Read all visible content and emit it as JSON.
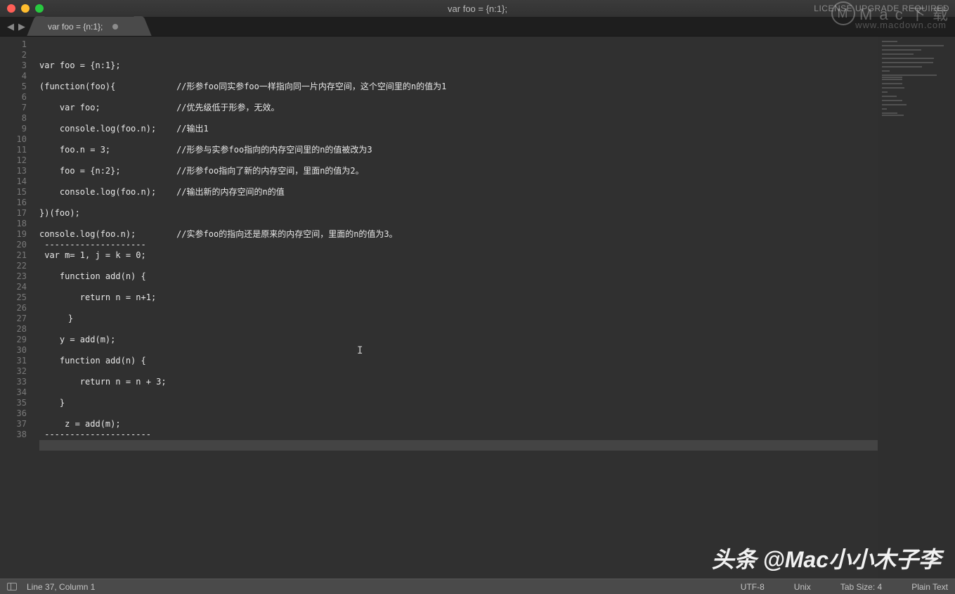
{
  "titlebar": {
    "title": "var foo = {n:1};",
    "right_text": "LICENSE UPGRADE REQUIRED"
  },
  "tab": {
    "label": "var foo = {n:1};"
  },
  "nav": {
    "back": "◀",
    "forward": "▶"
  },
  "lines": [
    "var foo = {n:1};",
    "",
    "(function(foo){            //形参foo同实参foo一样指向同一片内存空间，这个空间里的n的值为1",
    "",
    "    var foo;               //优先级低于形参，无效。",
    "",
    "    console.log(foo.n);    //输出1",
    "",
    "    foo.n = 3;             //形参与实参foo指向的内存空间里的n的值被改为3",
    "",
    "    foo = {n:2};           //形参foo指向了新的内存空间，里面n的值为2。",
    "",
    "    console.log(foo.n);    //输出新的内存空间的n的值",
    "",
    "})(foo);",
    "",
    "console.log(foo.n);        //实参foo的指向还是原来的内存空间，里面的n的值为3。",
    " --------------------",
    " var m= 1, j = k = 0;",
    "",
    "    function add(n) {",
    "",
    "        return n = n+1;",
    "",
    "　    }",
    "",
    "    y = add(m);",
    "",
    "    function add(n) {",
    "",
    "        return n = n + 3;",
    "",
    "    }",
    "",
    "     z = add(m);",
    " ---------------------",
    "",
    ""
  ],
  "line_count": 38,
  "current_line_index": 36,
  "status": {
    "position": "Line 37, Column 1",
    "encoding": "UTF-8",
    "line_ending": "Unix",
    "tab_size": "Tab Size: 4",
    "syntax": "Plain Text"
  },
  "watermark": {
    "brand": "M a c 下 载",
    "url": "www.macdown.com",
    "bottom": "头条 @Mac小小木子李"
  }
}
